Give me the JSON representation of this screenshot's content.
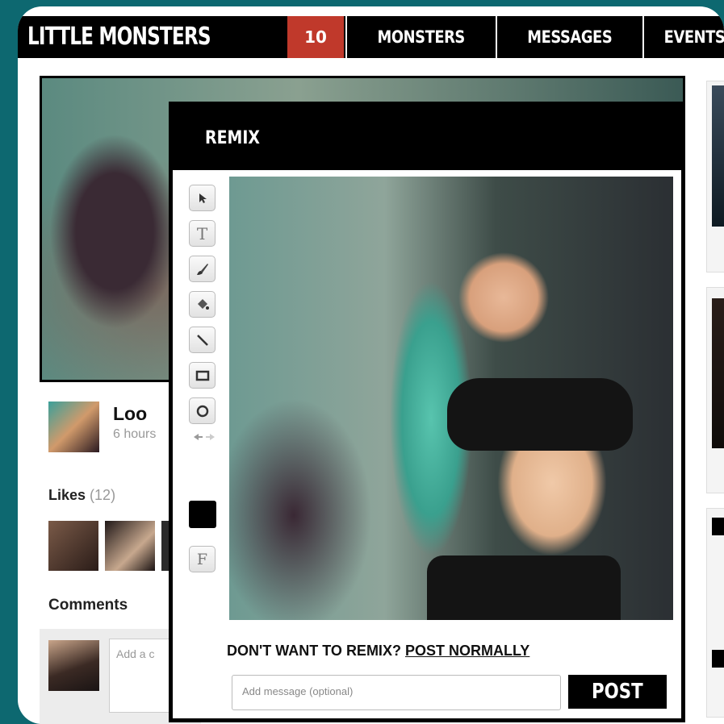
{
  "header": {
    "logo": "LITTLE MONSTERS",
    "notification_count": "10",
    "nav": [
      "MONSTERS",
      "MESSAGES",
      "EVENTS"
    ]
  },
  "post": {
    "username": "Loo",
    "time": "6 hours",
    "likes_label": "Likes",
    "likes_count": "(12)",
    "comments_label": "Comments",
    "comment_placeholder": "Add a c"
  },
  "modal": {
    "title": "REMIX",
    "tools": [
      "pointer-icon",
      "text-icon",
      "brush-icon",
      "fill-bucket-icon",
      "line-icon",
      "rectangle-icon",
      "ellipse-icon",
      "undo-redo-icon",
      "color-swatch",
      "font-icon"
    ],
    "tool_text": {
      "text": "T",
      "font": "F"
    },
    "prompt": "DON'T WANT TO REMIX?",
    "post_normally": "POST NORMALLY",
    "message_placeholder": "Add message (optional)",
    "post_label": "POST"
  },
  "colors": {
    "background": "#0d6870",
    "badge": "#c0392b",
    "nav": "#000000"
  }
}
